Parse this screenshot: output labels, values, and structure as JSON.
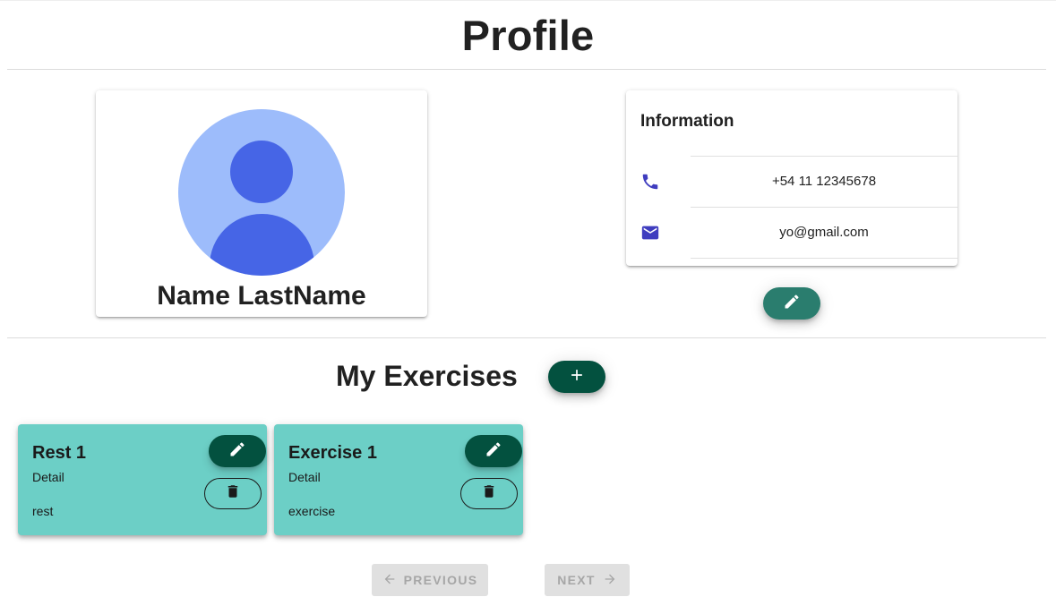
{
  "page": {
    "title": "Profile"
  },
  "profile": {
    "name": "Name LastName",
    "avatar_icon": "person-avatar-icon",
    "colors": {
      "avatar_bg": "#9dbcfb",
      "avatar_fg": "#4665e6"
    }
  },
  "information": {
    "title": "Information",
    "items": [
      {
        "icon": "phone-icon",
        "value": "+54 11 12345678"
      },
      {
        "icon": "mail-icon",
        "value": "yo@gmail.com"
      }
    ],
    "edit_icon": "pencil-icon",
    "icon_color": "#3f3dbf"
  },
  "exercises": {
    "title": "My Exercises",
    "add_icon": "plus-icon",
    "cards": [
      {
        "title": "Rest 1",
        "detail": "Detail",
        "type": "rest",
        "edit_icon": "pencil-icon",
        "delete_icon": "trash-icon"
      },
      {
        "title": "Exercise 1",
        "detail": "Detail",
        "type": "exercise",
        "edit_icon": "pencil-icon",
        "delete_icon": "trash-icon"
      }
    ],
    "card_color": "#6ccfc6",
    "button_color": "#03513f"
  },
  "pagination": {
    "previous_label": "PREVIOUS",
    "next_label": "NEXT",
    "previous_icon": "arrow-left-icon",
    "next_icon": "arrow-right-icon",
    "disabled": true
  }
}
